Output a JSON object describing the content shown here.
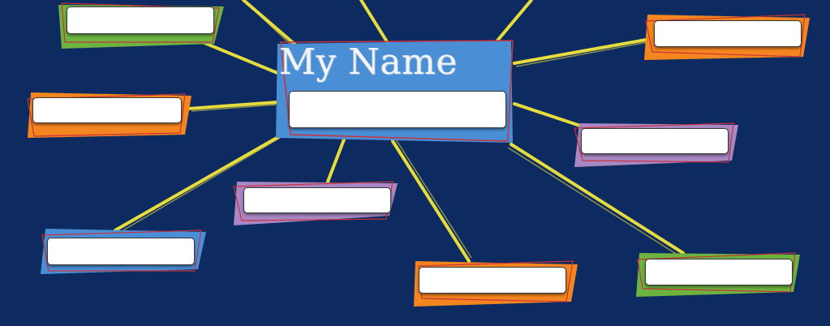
{
  "center": {
    "title": "My Name",
    "input_value": "",
    "color": "#4a8fd6"
  },
  "colors": {
    "background": "#0d2b60",
    "connector": "#f2e63c",
    "accent_frame": "#c8323a",
    "green": "#6db33f",
    "orange": "#f4861f",
    "purple": "#a987c4",
    "blue": "#4a8fd6"
  },
  "nodes": [
    {
      "id": "top-left",
      "color": "green",
      "input_value": ""
    },
    {
      "id": "mid-left",
      "color": "orange",
      "input_value": ""
    },
    {
      "id": "bottom-left",
      "color": "blue",
      "input_value": ""
    },
    {
      "id": "center-bottom",
      "color": "purple",
      "input_value": ""
    },
    {
      "id": "bottom-middle",
      "color": "orange",
      "input_value": ""
    },
    {
      "id": "bottom-right",
      "color": "green",
      "input_value": ""
    },
    {
      "id": "mid-right",
      "color": "purple",
      "input_value": ""
    },
    {
      "id": "top-right",
      "color": "orange",
      "input_value": ""
    }
  ]
}
